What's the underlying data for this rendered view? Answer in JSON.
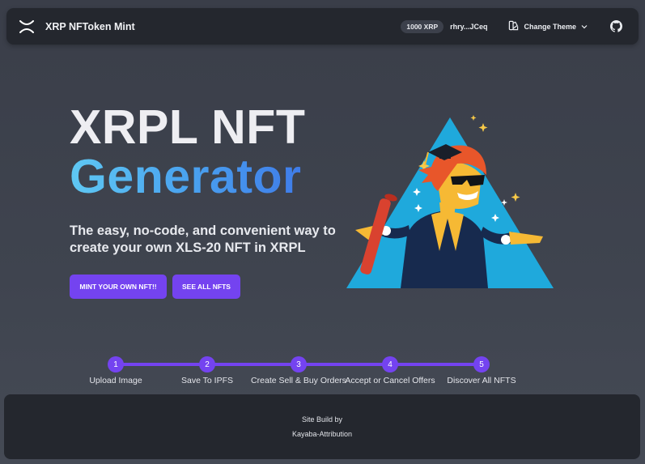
{
  "navbar": {
    "brand": "XRP NFToken Mint",
    "balance": "1000 XRP",
    "address": "rhry...JCeq",
    "theme_label": "Change Theme",
    "icons": [
      "xrp-logo-icon",
      "palette-icon",
      "chevron-down-icon",
      "github-icon"
    ]
  },
  "hero": {
    "title_line1": "XRPL NFT",
    "title_line2": "Generator",
    "subtitle": "The easy, no-code, and convenient way to create your own XLS-20 NFT in XRPL",
    "primary_button": "MINT YOUR OWN NFT!!",
    "secondary_button": "SEE ALL NFTS",
    "gradient_colors": [
      "#5fc8f3",
      "#3f7ce9"
    ]
  },
  "steps": [
    {
      "number": "1",
      "label": "Upload Image"
    },
    {
      "number": "2",
      "label": "Save To IPFS"
    },
    {
      "number": "3",
      "label": "Create Sell & Buy Orders"
    },
    {
      "number": "4",
      "label": "Accept or Cancel Offers"
    },
    {
      "number": "5",
      "label": "Discover All NFTS"
    }
  ],
  "footer": {
    "line1": "Site Build by",
    "line2": "Kayaba-Attribution"
  },
  "colors": {
    "accent": "#7443f0",
    "navbar_bg": "#24272e",
    "page_bg": "#3f444f"
  }
}
